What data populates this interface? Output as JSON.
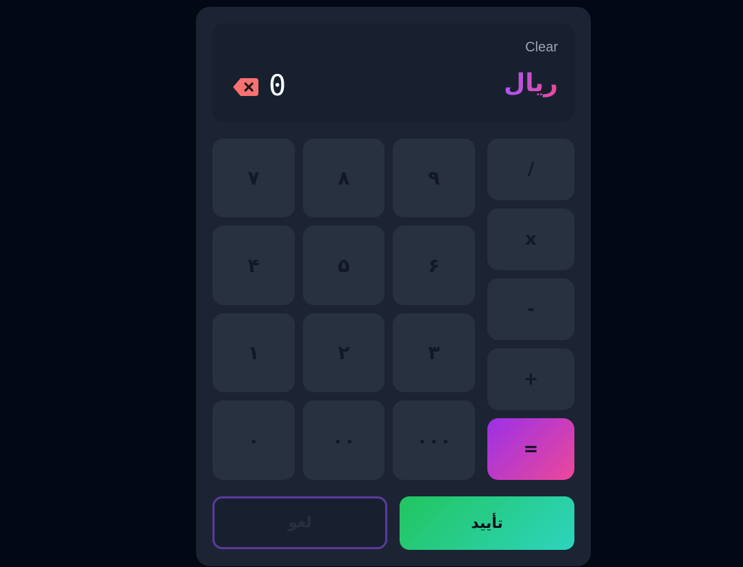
{
  "display": {
    "clear_label": "Clear",
    "currency": "ریال",
    "value": "0",
    "backspace_icon": "backspace-icon"
  },
  "keypad": {
    "digits": [
      [
        "۷",
        "۸",
        "۹"
      ],
      [
        "۴",
        "۵",
        "۶"
      ],
      [
        "۱",
        "۲",
        "۳"
      ],
      [
        "۰",
        "۰۰",
        "۰۰۰"
      ]
    ],
    "operators": [
      "/",
      "x",
      "-",
      "+",
      "="
    ]
  },
  "actions": {
    "cancel_label": "لغو",
    "confirm_label": "تأیید"
  },
  "colors": {
    "accent_gradient_start": "#9b30e8",
    "accent_gradient_end": "#ec4899",
    "confirm_gradient_start": "#22c55e",
    "confirm_gradient_end": "#2dd4bf",
    "backspace": "#f87171"
  }
}
